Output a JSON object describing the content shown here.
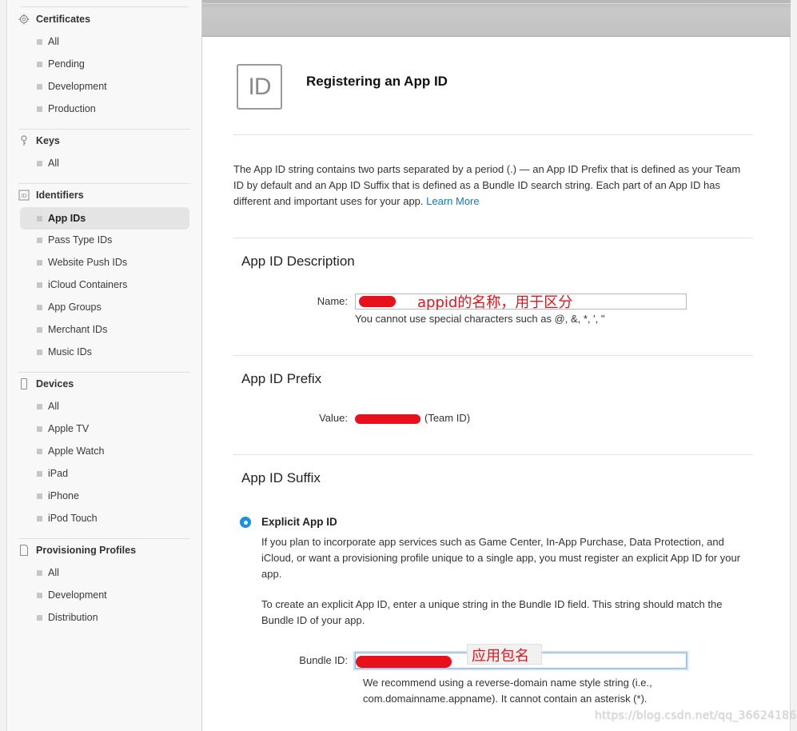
{
  "sidebar": {
    "sections": [
      {
        "title": "Certificates",
        "icon": "gear-icon",
        "items": [
          "All",
          "Pending",
          "Development",
          "Production"
        ]
      },
      {
        "title": "Keys",
        "icon": "key-icon",
        "items": [
          "All"
        ]
      },
      {
        "title": "Identifiers",
        "icon": "id-icon",
        "items": [
          "App IDs",
          "Pass Type IDs",
          "Website Push IDs",
          "iCloud Containers",
          "App Groups",
          "Merchant IDs",
          "Music IDs"
        ],
        "active": "App IDs"
      },
      {
        "title": "Devices",
        "icon": "device-icon",
        "items": [
          "All",
          "Apple TV",
          "Apple Watch",
          "iPad",
          "iPhone",
          "iPod Touch"
        ]
      },
      {
        "title": "Provisioning Profiles",
        "icon": "document-icon",
        "items": [
          "All",
          "Development",
          "Distribution"
        ]
      }
    ]
  },
  "header": {
    "icon_text": "ID",
    "title": "Registering an App ID"
  },
  "intro": {
    "text": "The App ID string contains two parts separated by a period (.) — an App ID Prefix that is defined as your Team ID by default and an App ID Suffix that is defined as a Bundle ID search string. Each part of an App ID has different and important uses for your app.",
    "link": "Learn More"
  },
  "description_section": {
    "title": "App ID Description",
    "name_label": "Name:",
    "name_annotation": "appid的名称，用于区分",
    "help": "You cannot use special characters such as @, &, *, ', \""
  },
  "prefix_section": {
    "title": "App ID Prefix",
    "value_label": "Value:",
    "value_suffix": "(Team ID)"
  },
  "suffix_section": {
    "title": "App ID Suffix",
    "option_label": "Explicit App ID",
    "para1": "If you plan to incorporate app services such as Game Center, In-App Purchase, Data Protection, and iCloud, or want a provisioning profile unique to a single app, you must register an explicit App ID for your app.",
    "para2": "To create an explicit App ID, enter a unique string in the Bundle ID field. This string should match the Bundle ID of your app.",
    "bundle_label": "Bundle ID:",
    "bundle_annotation": "应用包名",
    "help": "We recommend using a reverse-domain name style string (i.e., com.domainname.appname). It cannot contain an asterisk (*)."
  },
  "watermark": "https://blog.csdn.net/qq_36624186",
  "colors": {
    "accent": "#0a7bc4",
    "radio": "#1a8fe3",
    "annotation": "#e5131b"
  }
}
